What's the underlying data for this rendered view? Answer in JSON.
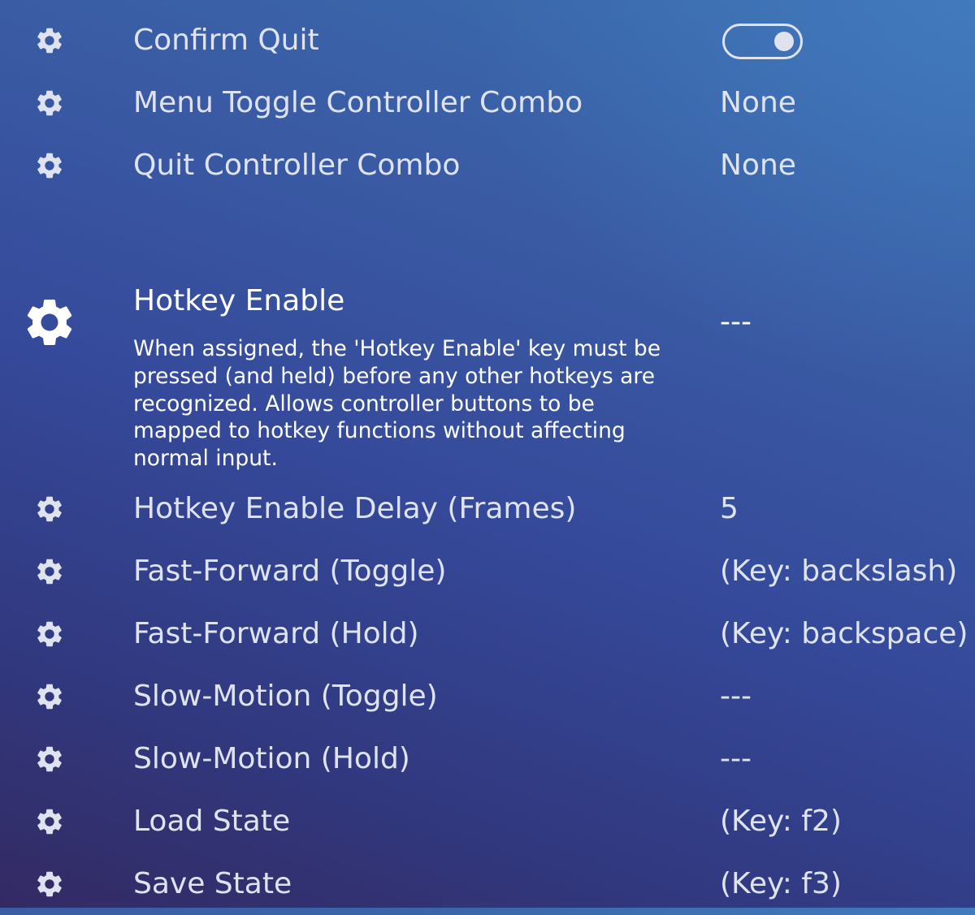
{
  "colors": {
    "text": "#dfe3ef",
    "selected_text": "#ffffff",
    "bg_top": "#3b70b0",
    "bg_bottom": "#332a63"
  },
  "settings": {
    "top": [
      {
        "label": "Confirm Quit",
        "control": "toggle",
        "toggle_on": true,
        "icon": "gear-icon"
      },
      {
        "label": "Menu Toggle Controller Combo",
        "value": "None",
        "icon": "gear-icon"
      },
      {
        "label": "Quit Controller Combo",
        "value": "None",
        "icon": "gear-icon"
      }
    ],
    "selected": {
      "label": "Hotkey Enable",
      "value": "---",
      "description": "When assigned, the 'Hotkey Enable' key must be pressed (and held) before any other hotkeys are recognized. Allows controller buttons to be mapped to hotkey functions without affecting normal input.",
      "icon": "gear-icon"
    },
    "bottom": [
      {
        "label": "Hotkey Enable Delay (Frames)",
        "value": "5",
        "icon": "gear-icon"
      },
      {
        "label": "Fast-Forward (Toggle)",
        "value": "(Key: backslash)",
        "icon": "gear-icon"
      },
      {
        "label": "Fast-Forward (Hold)",
        "value": "(Key: backspace)",
        "icon": "gear-icon"
      },
      {
        "label": "Slow-Motion (Toggle)",
        "value": "---",
        "icon": "gear-icon"
      },
      {
        "label": "Slow-Motion (Hold)",
        "value": "---",
        "icon": "gear-icon"
      },
      {
        "label": "Load State",
        "value": "(Key: f2)",
        "icon": "gear-icon"
      },
      {
        "label": "Save State",
        "value": "(Key: f3)",
        "icon": "gear-icon"
      }
    ]
  }
}
